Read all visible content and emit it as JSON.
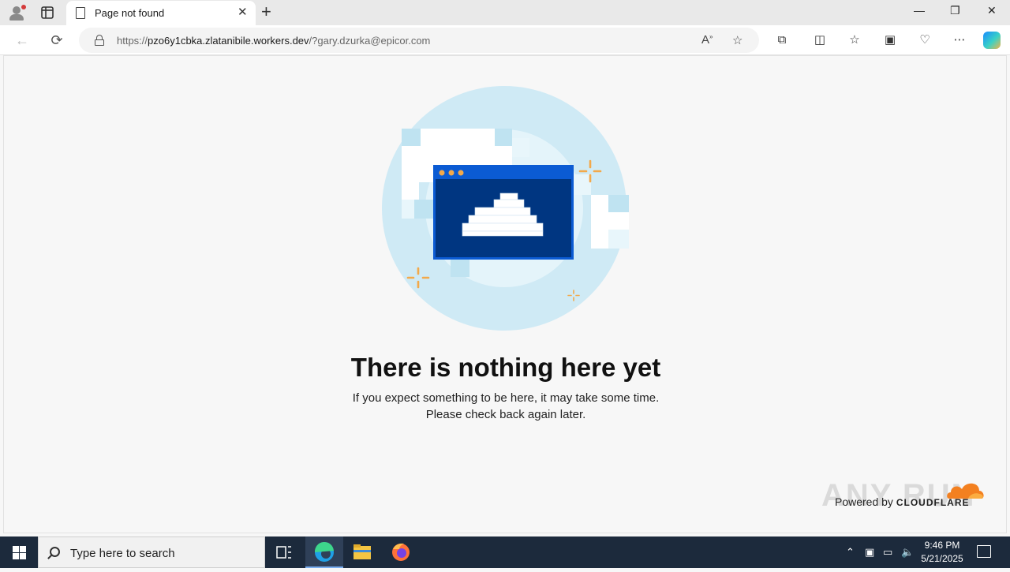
{
  "browser": {
    "tab": {
      "title": "Page not found",
      "close": "✕"
    },
    "new_tab": "+",
    "window_controls": {
      "minimize": "—",
      "restore": "❐",
      "close": "✕"
    },
    "address": {
      "scheme": "https://",
      "host": "pzo6y1cbka.zlatanibile.workers.dev",
      "path": "/?gary.dzurka@epicor.com"
    }
  },
  "page": {
    "headline": "There is nothing here yet",
    "line1": "If you expect something to be here, it may take some time.",
    "line2": "Please check back again later.",
    "powered_by": "Powered by",
    "brand": "CLOUDFLARE",
    "watermark": "ANY RUN",
    "colors": {
      "circle": "#cfeaf5",
      "window_frame": "#0b5bd3",
      "window_body": "#003681",
      "sparkle": "#f3a94a"
    }
  },
  "taskbar": {
    "search_placeholder": "Type here to search",
    "time": "9:46 PM",
    "date": "5/21/2025"
  }
}
